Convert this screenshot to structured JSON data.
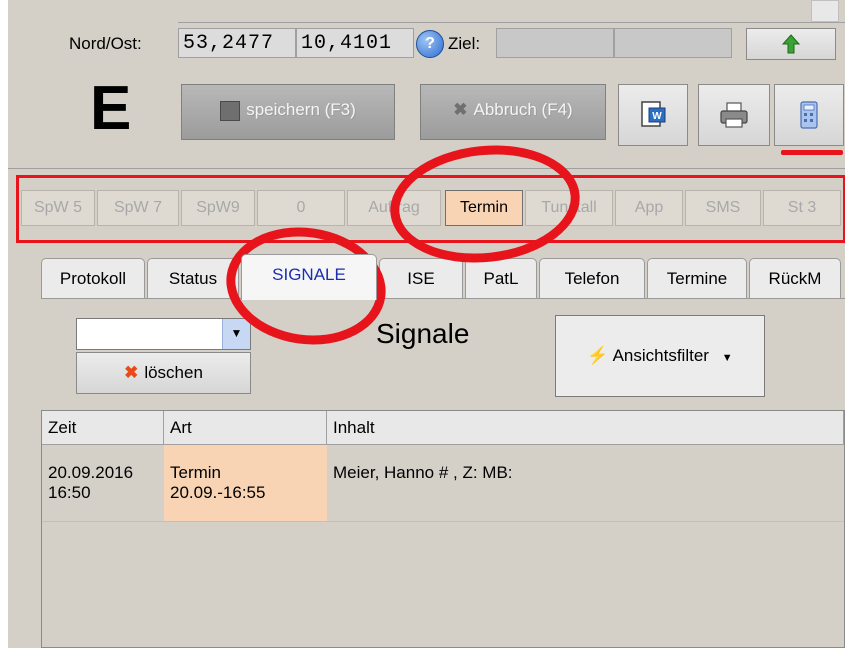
{
  "header": {
    "coord_label": "Nord/Ost:",
    "lat": "53,2477",
    "lon": "10,4101",
    "help_icon": "help-question-icon",
    "ziel_label": "Ziel:",
    "status_letter": "E"
  },
  "toolbar": {
    "save_label": "speichern (F3)",
    "cancel_label": "Abbruch (F4)",
    "up_arrow_icon": "arrow-up-icon",
    "save_icon": "floppy-disk-icon",
    "cancel_icon": "cross-icon",
    "word_icon": "word-document-icon",
    "print_icon": "printer-icon",
    "calc_icon": "calculator-icon"
  },
  "status_buttons": [
    {
      "label": "SpW 5",
      "active": false
    },
    {
      "label": "SpW 7",
      "active": false
    },
    {
      "label": "SpW9",
      "active": false
    },
    {
      "label": "0",
      "active": false
    },
    {
      "label": "Auftrag",
      "active": false
    },
    {
      "label": "Termin",
      "active": true
    },
    {
      "label": "Tunstall",
      "active": false
    },
    {
      "label": "App",
      "active": false
    },
    {
      "label": "SMS",
      "active": false
    },
    {
      "label": "St 3",
      "active": false
    }
  ],
  "tabs": [
    {
      "label": "Protokoll"
    },
    {
      "label": "Status"
    },
    {
      "label": "SIGNALE",
      "active": true
    },
    {
      "label": "ISE"
    },
    {
      "label": "PatL"
    },
    {
      "label": "Telefon"
    },
    {
      "label": "Termine"
    },
    {
      "label": "RückM"
    }
  ],
  "signale": {
    "title": "Signale",
    "combo_value": "",
    "delete_label": "löschen",
    "filter_label": "Ansichtsfilter"
  },
  "grid": {
    "columns": [
      "Zeit",
      "Art",
      "Inhalt"
    ],
    "rows": [
      {
        "zeit": "20.09.2016\n16:50",
        "art": "Termin\n20.09.-16:55",
        "inhalt": "Meier, Hanno # , Z: MB:"
      }
    ]
  },
  "colors": {
    "highlight": "#f8d4b4",
    "annotation_red": "#e8141c",
    "active_tab_text": "#1a2fb0"
  }
}
